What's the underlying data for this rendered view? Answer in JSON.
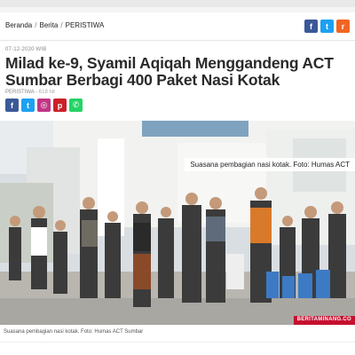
{
  "breadcrumb": {
    "items": [
      "Beranda",
      "Berita",
      "PERISTIWA"
    ],
    "separator": "/"
  },
  "share_top": [
    {
      "icon": "facebook-icon",
      "glyph": "f",
      "color": "#3b5998"
    },
    {
      "icon": "twitter-icon",
      "glyph": "t",
      "color": "#1da1f2"
    },
    {
      "icon": "rss-icon",
      "glyph": "r",
      "color": "#f26522"
    }
  ],
  "article": {
    "date": "07-12-2020 WIB",
    "title": "Milad ke-9, Syamil Aqiqah Menggandeng ACT Sumbar Berbagi 400 Paket Nasi Kotak",
    "category": "PERISTIWA",
    "views": "618 hit"
  },
  "share_row": [
    {
      "icon": "facebook-icon",
      "glyph": "f",
      "color": "#3b5998"
    },
    {
      "icon": "twitter-icon",
      "glyph": "t",
      "color": "#1da1f2"
    },
    {
      "icon": "instagram-icon",
      "glyph": "◎",
      "color": "#c13584"
    },
    {
      "icon": "pinterest-icon",
      "glyph": "p",
      "color": "#cb2027"
    },
    {
      "icon": "whatsapp-icon",
      "glyph": "✆",
      "color": "#25d366"
    }
  ],
  "photo": {
    "overlay_caption": "Suasana pembagian nasi kotak. Foto: Humas ACT",
    "watermark": "BERITAMINANG.CO",
    "caption": "Suasana pembagian nasi kotak. Foto: Humas ACT Sumbar"
  }
}
